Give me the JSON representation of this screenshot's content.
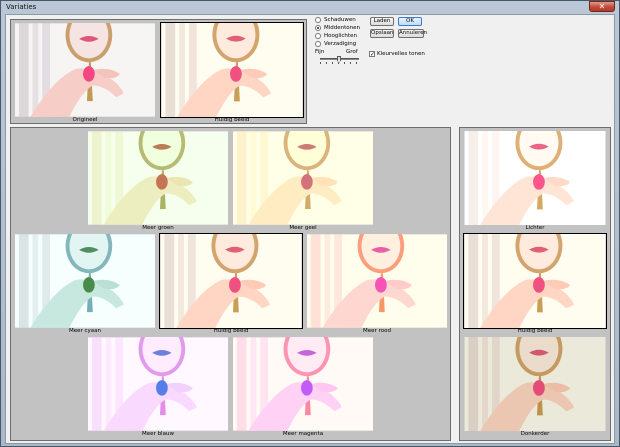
{
  "window": {
    "title": "Variaties",
    "close_label": "✕"
  },
  "preview": {
    "original_label": "Origineel",
    "current_label": "Huidig beeld"
  },
  "tone": {
    "options": [
      "Schaduwen",
      "Middentonen",
      "Hooglichten",
      "Verzadiging"
    ],
    "selected": "Middentonen"
  },
  "slider": {
    "fine_label": "Fijn",
    "coarse_label": "Grof",
    "level": 0.5
  },
  "buttons": {
    "load": "Laden",
    "ok": "OK",
    "save": "Opslaan",
    "cancel": "Annuleren"
  },
  "clipping": {
    "label": "Kleurvelles tonen",
    "checked": true
  },
  "color_variations": {
    "more_green": "Meer groen",
    "more_yellow": "Meer geel",
    "more_cyan": "Meer cyaan",
    "current": "Huidig beeld",
    "more_red": "Meer rood",
    "more_blue": "Meer blauw",
    "more_magenta": "Meer magenta"
  },
  "brightness": {
    "lighter": "Lichter",
    "current": "Huidig beeld",
    "darker": "Donkerder"
  },
  "colors": {
    "accent": "#3a7bd5",
    "panel": "#c2c2c2",
    "dialog": "#f0f0f0"
  }
}
